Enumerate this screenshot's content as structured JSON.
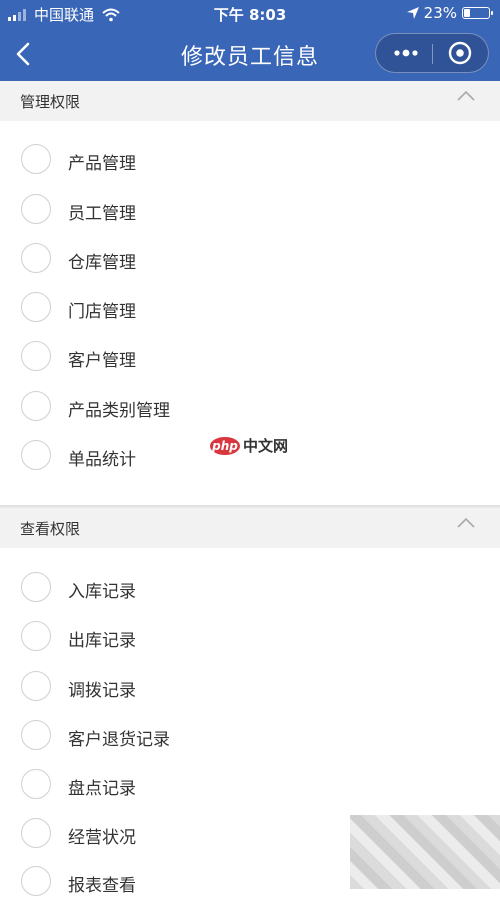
{
  "status_bar": {
    "carrier": "中国联通",
    "time": "下午 8:03",
    "battery": "23%"
  },
  "nav": {
    "title": "修改员工信息"
  },
  "sections": [
    {
      "title": "管理权限",
      "items": [
        "产品管理",
        "员工管理",
        "仓库管理",
        "门店管理",
        "客户管理",
        "产品类别管理",
        "单品统计"
      ]
    },
    {
      "title": "查看权限",
      "items": [
        "入库记录",
        "出库记录",
        "调拨记录",
        "客户退货记录",
        "盘点记录",
        "经营状况",
        "报表查看"
      ]
    }
  ],
  "watermark": {
    "badge": "php",
    "text": "中文网"
  },
  "colors": {
    "header": "#3a66b8",
    "section_bg": "#f2f2f2",
    "radio_border": "#d0d0d0"
  }
}
